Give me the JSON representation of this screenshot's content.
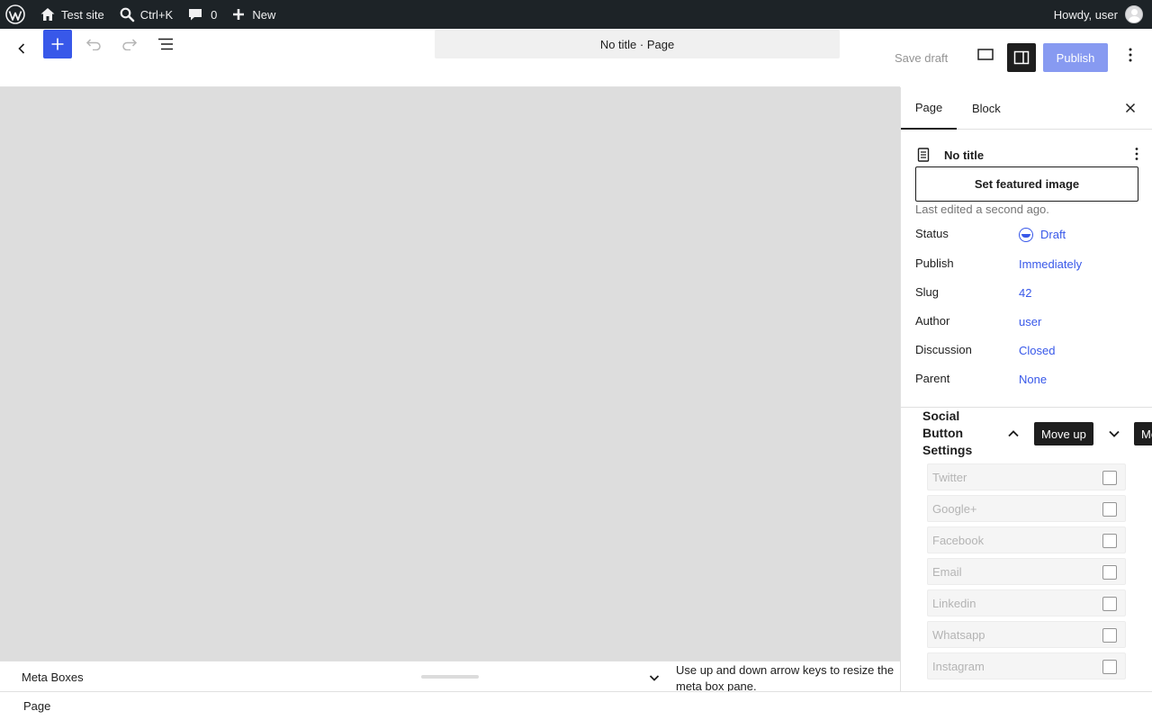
{
  "adminbar": {
    "site_name": "Test site",
    "search_shortcut": "Ctrl+K",
    "comments_count": "0",
    "new_label": "New",
    "howdy": "Howdy, user"
  },
  "header": {
    "document_bar": "No title · Page",
    "save_draft": "Save draft",
    "publish": "Publish"
  },
  "sidebar": {
    "tabs": [
      {
        "label": "Page"
      },
      {
        "label": "Block"
      }
    ],
    "doc_title": "No title",
    "featured_image_button": "Set featured image",
    "last_edited": "Last edited a second ago.",
    "properties": [
      {
        "label": "Status",
        "value": "Draft"
      },
      {
        "label": "Publish",
        "value": "Immediately"
      },
      {
        "label": "Slug",
        "value": "42"
      },
      {
        "label": "Author",
        "value": "user"
      },
      {
        "label": "Discussion",
        "value": "Closed"
      },
      {
        "label": "Parent",
        "value": "None"
      }
    ],
    "social": {
      "title": "Social Button Settings",
      "move_up_tooltip": "Move up",
      "move_down_tooltip": "Move down",
      "items": [
        {
          "label": "Twitter",
          "checked": false
        },
        {
          "label": "Google+",
          "checked": false
        },
        {
          "label": "Facebook",
          "checked": false
        },
        {
          "label": "Email",
          "checked": false
        },
        {
          "label": "Linkedin",
          "checked": false
        },
        {
          "label": "Whatsapp",
          "checked": false
        },
        {
          "label": "Instagram",
          "checked": false
        }
      ]
    }
  },
  "metaboxes": {
    "title": "Meta Boxes",
    "resize_hint": "Use up and down arrow keys to resize the meta box pane."
  },
  "footer": {
    "breadcrumb": "Page"
  },
  "colors": {
    "accent": "#3858e9",
    "adminbar": "#1d2327",
    "canvas": "#dddddd"
  }
}
